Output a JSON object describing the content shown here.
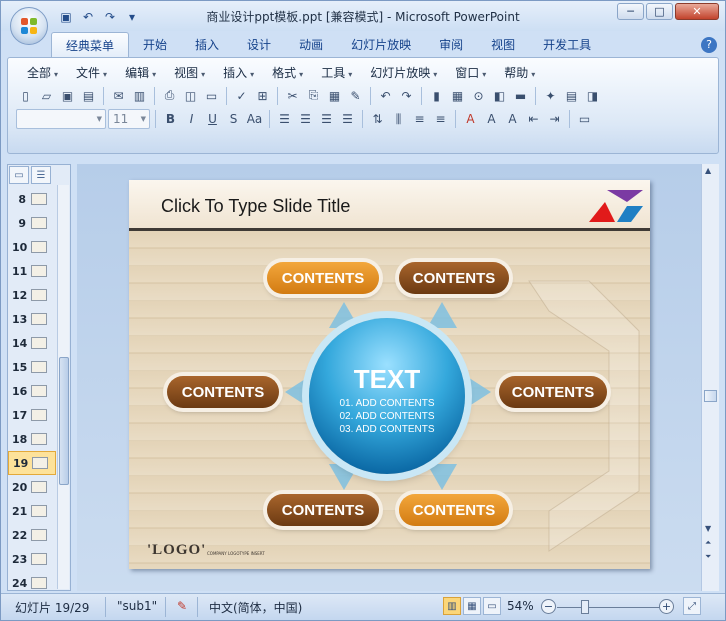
{
  "window": {
    "title": "商业设计ppt模板.ppt [兼容模式] - Microsoft PowerPoint",
    "controls": [
      "minimize",
      "maximize",
      "close"
    ]
  },
  "quick_access": {
    "icons": [
      "save-icon",
      "undo-icon",
      "redo-icon",
      "customize-icon"
    ]
  },
  "tabs": [
    {
      "label": "经典菜单",
      "active": true
    },
    {
      "label": "开始"
    },
    {
      "label": "插入"
    },
    {
      "label": "设计"
    },
    {
      "label": "动画"
    },
    {
      "label": "幻灯片放映"
    },
    {
      "label": "审阅"
    },
    {
      "label": "视图"
    },
    {
      "label": "开发工具"
    }
  ],
  "menus": [
    "全部",
    "文件",
    "编辑",
    "视图",
    "插入",
    "格式",
    "工具",
    "幻灯片放映",
    "窗口",
    "帮助"
  ],
  "toolbar": {
    "font_size": "11"
  },
  "slides_panel": {
    "thumbnails": [
      {
        "num": "8"
      },
      {
        "num": "9"
      },
      {
        "num": "10"
      },
      {
        "num": "11"
      },
      {
        "num": "12"
      },
      {
        "num": "13"
      },
      {
        "num": "14"
      },
      {
        "num": "15"
      },
      {
        "num": "16"
      },
      {
        "num": "17"
      },
      {
        "num": "18"
      },
      {
        "num": "19",
        "selected": true
      },
      {
        "num": "20"
      },
      {
        "num": "21"
      },
      {
        "num": "22"
      },
      {
        "num": "23"
      },
      {
        "num": "24"
      }
    ]
  },
  "slide": {
    "title": "Click To Type Slide Title",
    "center_title": "TEXT",
    "center_lines": [
      "01. ADD CONTENTS",
      "02. ADD CONTENTS",
      "03. ADD CONTENTS"
    ],
    "pills": [
      {
        "label": "CONTENTS",
        "style": "orange"
      },
      {
        "label": "CONTENTS",
        "style": "brown"
      },
      {
        "label": "CONTENTS",
        "style": "brown"
      },
      {
        "label": "CONTENTS",
        "style": "brown"
      },
      {
        "label": "CONTENTS",
        "style": "brown"
      },
      {
        "label": "CONTENTS",
        "style": "orange"
      }
    ],
    "logo": "'LOGO'",
    "logo_sub": "COMPANY LOGOTYPE INSERT"
  },
  "status": {
    "slide_counter": "幻灯片 19/29",
    "theme": "\"sub1\"",
    "language": "中文(简体，中国)",
    "zoom": "54%"
  },
  "colors": {
    "accent_blue": "#15428b",
    "pill_brown": "#7a4418",
    "pill_orange": "#e28f22",
    "sphere_blue": "#1f8fcb"
  }
}
